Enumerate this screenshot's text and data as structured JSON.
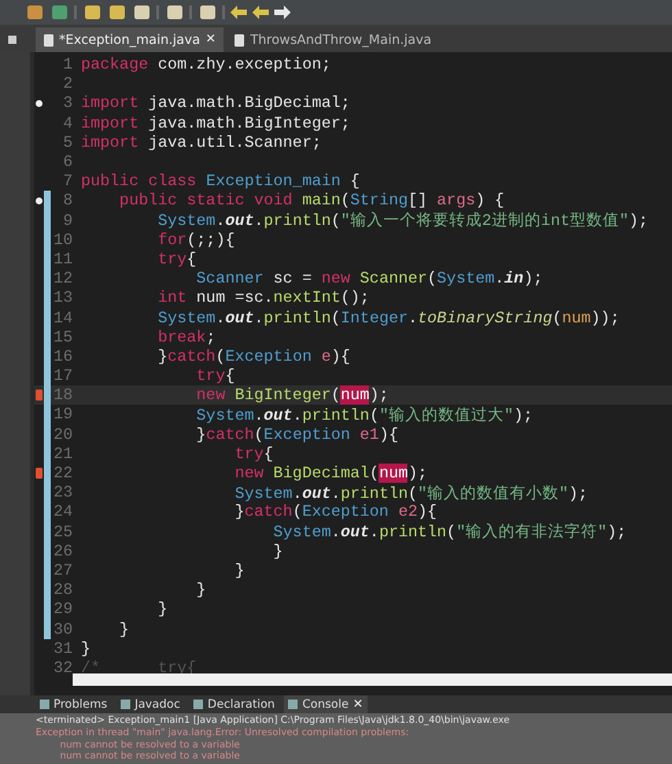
{
  "editor_tabs": [
    {
      "label": "*Exception_main.java",
      "selected": true,
      "close": "✕"
    },
    {
      "label": "ThrowsAndThrow_Main.java",
      "selected": false
    }
  ],
  "code_lines": [
    {
      "number": "1",
      "tokens": [
        {
          "kind": "kw",
          "text": "package"
        },
        {
          "kind": "plain",
          "text": " com.zhy.exception;"
        }
      ]
    },
    {
      "number": "2"
    },
    {
      "number": "3",
      "fold": true,
      "tokens": [
        {
          "kind": "kw",
          "text": "import"
        },
        {
          "kind": "plain",
          "text": " java.math.BigDecimal;"
        }
      ]
    },
    {
      "number": "4",
      "tokens": [
        {
          "kind": "kw",
          "text": "import"
        },
        {
          "kind": "plain",
          "text": " java.math.BigInteger;"
        }
      ]
    },
    {
      "number": "5",
      "tokens": [
        {
          "kind": "kw",
          "text": "import"
        },
        {
          "kind": "plain",
          "text": " java.util.Scanner;"
        }
      ]
    },
    {
      "number": "6"
    },
    {
      "number": "7",
      "tokens": [
        {
          "kind": "kw",
          "text": "public class "
        },
        {
          "kind": "type",
          "text": "Exception_main"
        },
        {
          "kind": "plain",
          "text": " {"
        }
      ]
    },
    {
      "number": "8",
      "fold": true,
      "changed": true,
      "tokens": [
        {
          "kind": "kw",
          "text": "    public static void "
        },
        {
          "kind": "method",
          "text": "main"
        },
        {
          "kind": "plain",
          "text": "("
        },
        {
          "kind": "type",
          "text": "String"
        },
        {
          "kind": "plain",
          "text": "[] "
        },
        {
          "kind": "param",
          "text": "args"
        },
        {
          "kind": "plain",
          "text": ") {"
        }
      ]
    },
    {
      "number": "9",
      "changed": true,
      "tokens": [
        {
          "kind": "type",
          "text": "        System"
        },
        {
          "kind": "plain",
          "text": "."
        },
        {
          "kind": "field",
          "text": "out"
        },
        {
          "kind": "plain",
          "text": "."
        },
        {
          "kind": "method",
          "text": "println"
        },
        {
          "kind": "plain",
          "text": "("
        },
        {
          "kind": "str",
          "text": "\"输入一个将要转成2进制的int型数值\""
        },
        {
          "kind": "plain",
          "text": ");"
        }
      ]
    },
    {
      "number": "10",
      "changed": true,
      "tokens": [
        {
          "kind": "kw",
          "text": "        for"
        },
        {
          "kind": "plain",
          "text": "(;;){"
        }
      ]
    },
    {
      "number": "11",
      "changed": true,
      "tokens": [
        {
          "kind": "kw",
          "text": "        try"
        },
        {
          "kind": "plain",
          "text": "{"
        }
      ]
    },
    {
      "number": "12",
      "changed": true,
      "tokens": [
        {
          "kind": "type",
          "text": "            Scanner"
        },
        {
          "kind": "plain",
          "text": " sc = "
        },
        {
          "kind": "kw",
          "text": "new "
        },
        {
          "kind": "method",
          "text": "Scanner"
        },
        {
          "kind": "plain",
          "text": "("
        },
        {
          "kind": "type",
          "text": "System"
        },
        {
          "kind": "plain",
          "text": "."
        },
        {
          "kind": "field",
          "text": "in"
        },
        {
          "kind": "plain",
          "text": ");"
        }
      ]
    },
    {
      "number": "13",
      "changed": true,
      "tokens": [
        {
          "kind": "kw",
          "text": "        int "
        },
        {
          "kind": "plain",
          "text": "num =sc."
        },
        {
          "kind": "method",
          "text": "nextInt"
        },
        {
          "kind": "plain",
          "text": "();"
        }
      ]
    },
    {
      "number": "14",
      "changed": true,
      "tokens": [
        {
          "kind": "type",
          "text": "        System"
        },
        {
          "kind": "plain",
          "text": "."
        },
        {
          "kind": "field",
          "text": "out"
        },
        {
          "kind": "plain",
          "text": "."
        },
        {
          "kind": "method",
          "text": "println"
        },
        {
          "kind": "plain",
          "text": "("
        },
        {
          "kind": "type",
          "text": "Integer"
        },
        {
          "kind": "plain",
          "text": "."
        },
        {
          "kind": "static",
          "text": "toBinaryString"
        },
        {
          "kind": "plain",
          "text": "("
        },
        {
          "kind": "var",
          "text": "num"
        },
        {
          "kind": "plain",
          "text": "));"
        }
      ]
    },
    {
      "number": "15",
      "changed": true,
      "tokens": [
        {
          "kind": "kw",
          "text": "        break"
        },
        {
          "kind": "plain",
          "text": ";"
        }
      ]
    },
    {
      "number": "16",
      "changed": true,
      "tokens": [
        {
          "kind": "plain",
          "text": "        }"
        },
        {
          "kind": "kw",
          "text": "catch"
        },
        {
          "kind": "plain",
          "text": "("
        },
        {
          "kind": "type",
          "text": "Exception"
        },
        {
          "kind": "param",
          "text": " e"
        },
        {
          "kind": "plain",
          "text": "){"
        }
      ]
    },
    {
      "number": "17",
      "changed": true,
      "tokens": [
        {
          "kind": "kw",
          "text": "            try"
        },
        {
          "kind": "plain",
          "text": "{"
        }
      ]
    },
    {
      "number": "18",
      "changed": true,
      "current": true,
      "error": true,
      "tokens": [
        {
          "kind": "kw",
          "text": "            new "
        },
        {
          "kind": "method",
          "text": "BigInteger"
        },
        {
          "kind": "plain",
          "text": "("
        },
        {
          "kind": "err",
          "text": "num"
        },
        {
          "kind": "plain",
          "text": ");"
        }
      ]
    },
    {
      "number": "19",
      "changed": true,
      "tokens": [
        {
          "kind": "type",
          "text": "            System"
        },
        {
          "kind": "plain",
          "text": "."
        },
        {
          "kind": "field",
          "text": "out"
        },
        {
          "kind": "plain",
          "text": "."
        },
        {
          "kind": "method",
          "text": "println"
        },
        {
          "kind": "plain",
          "text": "("
        },
        {
          "kind": "str",
          "text": "\"输入的数值过大\""
        },
        {
          "kind": "plain",
          "text": ");"
        }
      ]
    },
    {
      "number": "20",
      "changed": true,
      "tokens": [
        {
          "kind": "plain",
          "text": "            }"
        },
        {
          "kind": "kw",
          "text": "catch"
        },
        {
          "kind": "plain",
          "text": "("
        },
        {
          "kind": "type",
          "text": "Exception"
        },
        {
          "kind": "param",
          "text": " e1"
        },
        {
          "kind": "plain",
          "text": "){"
        }
      ]
    },
    {
      "number": "21",
      "changed": true,
      "tokens": [
        {
          "kind": "kw",
          "text": "                try"
        },
        {
          "kind": "plain",
          "text": "{"
        }
      ]
    },
    {
      "number": "22",
      "changed": true,
      "error": true,
      "tokens": [
        {
          "kind": "kw",
          "text": "                new "
        },
        {
          "kind": "method",
          "text": "BigDecimal"
        },
        {
          "kind": "plain",
          "text": "("
        },
        {
          "kind": "err",
          "text": "num"
        },
        {
          "kind": "plain",
          "text": ");"
        }
      ]
    },
    {
      "number": "23",
      "changed": true,
      "tokens": [
        {
          "kind": "type",
          "text": "                System"
        },
        {
          "kind": "plain",
          "text": "."
        },
        {
          "kind": "field",
          "text": "out"
        },
        {
          "kind": "plain",
          "text": "."
        },
        {
          "kind": "method",
          "text": "println"
        },
        {
          "kind": "plain",
          "text": "("
        },
        {
          "kind": "str",
          "text": "\"输入的数值有小数\""
        },
        {
          "kind": "plain",
          "text": ");"
        }
      ]
    },
    {
      "number": "24",
      "changed": true,
      "tokens": [
        {
          "kind": "plain",
          "text": "                }"
        },
        {
          "kind": "kw",
          "text": "catch"
        },
        {
          "kind": "plain",
          "text": "("
        },
        {
          "kind": "type",
          "text": "Exception"
        },
        {
          "kind": "param",
          "text": " e2"
        },
        {
          "kind": "plain",
          "text": "){"
        }
      ]
    },
    {
      "number": "25",
      "changed": true,
      "tokens": [
        {
          "kind": "type",
          "text": "                    System"
        },
        {
          "kind": "plain",
          "text": "."
        },
        {
          "kind": "field",
          "text": "out"
        },
        {
          "kind": "plain",
          "text": "."
        },
        {
          "kind": "method",
          "text": "println"
        },
        {
          "kind": "plain",
          "text": "("
        },
        {
          "kind": "str",
          "text": "\"输入的有非法字符\""
        },
        {
          "kind": "plain",
          "text": ");"
        }
      ]
    },
    {
      "number": "26",
      "changed": true,
      "tokens": [
        {
          "kind": "plain",
          "text": "                    }"
        }
      ]
    },
    {
      "number": "27",
      "changed": true,
      "tokens": [
        {
          "kind": "plain",
          "text": "                }"
        }
      ]
    },
    {
      "number": "28",
      "changed": true,
      "tokens": [
        {
          "kind": "plain",
          "text": "            }"
        }
      ]
    },
    {
      "number": "29",
      "changed": true,
      "tokens": [
        {
          "kind": "plain",
          "text": "        }"
        }
      ]
    },
    {
      "number": "30",
      "changed": true,
      "tokens": [
        {
          "kind": "plain",
          "text": "    }"
        }
      ]
    },
    {
      "number": "31",
      "tokens": [
        {
          "kind": "plain",
          "text": "}"
        }
      ]
    },
    {
      "number": "32",
      "tokens": [
        {
          "kind": "comment",
          "text": "/*      try{"
        }
      ]
    }
  ],
  "view_tabs": [
    {
      "label": "Problems",
      "selected": false
    },
    {
      "label": "Javadoc",
      "selected": false
    },
    {
      "label": "Declaration",
      "selected": false
    },
    {
      "label": "Console",
      "selected": true,
      "close": "✕"
    }
  ],
  "console": {
    "header": "<terminated> Exception_main1 [Java Application] C:\\Program Files\\Java\\jdk1.8.0_40\\bin\\javaw.exe",
    "error_lines": [
      "Exception in thread \"main\" java.lang.Error: Unresolved compilation problems:",
      "        num cannot be resolved to a variable",
      "        num cannot be resolved to a variable"
    ]
  }
}
